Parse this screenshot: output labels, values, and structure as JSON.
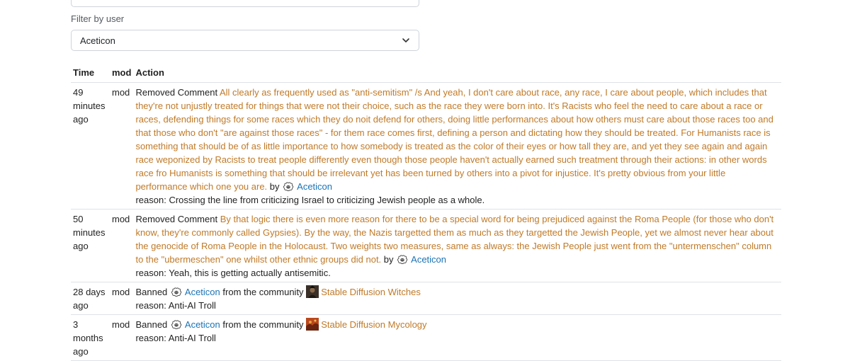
{
  "filter": {
    "label": "Filter by user",
    "selected_user": "Aceticon",
    "top_select_value": ""
  },
  "table": {
    "headers": {
      "time": "Time",
      "mod": "mod",
      "action": "Action"
    },
    "rows": [
      {
        "time": "49 minutes ago",
        "mod": "mod",
        "action": "Removed Comment",
        "content": "All clearly as frequently used as \"anti-semitism\" /s And yeah, I don't care about race, any race, I care about people, which includes that they're not unjustly treated for things that were not their choice, such as the race they were born into. It's Racists who feel the need to care about a race or races, defending things for some races which they do noit defend for others, doing little performances about how others must care about those races too and that those who don't \"are against those races\" - for them race comes first, defining a person and dictating how they should be treated. For Humanists race is something that should be of as little importance to how somebody is treated as the color of their eyes or how tall they are, and yet they see again and again race weponized by Racists to treat people differently even though those people haven't actually earned such treatment through their actions: in other words race fro Humanists is something that should be irrelevant yet has been turned by others into a pivot for injustice. It's pretty obvious from your little performance which one you are.",
        "by": "by",
        "user": "Aceticon",
        "reason_prefix": "reason:",
        "reason": "Crossing the line from criticizing Israel to criticizing Jewish people as a whole."
      },
      {
        "time": "50 minutes ago",
        "mod": "mod",
        "action": "Removed Comment",
        "content": "By that logic there is even more reason for there to be a special word for being prejudiced against the Roma People (for those who don't know, they're commonly called Gypsies). By the way, the Nazis targetted them as much as they targetted the Jewish People, yet we almost never hear about the genocide of Roma People in the Holocaust. Two weights two measures, same as always: the Jewish People just went from the \"untermenschen\" column to the \"ubermeschen\" one whilst other ethnic groups did not.",
        "by": "by",
        "user": "Aceticon",
        "reason_prefix": "reason:",
        "reason": "Yeah, this is getting actually antisemitic."
      },
      {
        "time": "28 days ago",
        "mod": "mod",
        "action": "Banned",
        "user": "Aceticon",
        "from_text": "from the community",
        "community": "Stable Diffusion Witches",
        "community_icon_color": "#3a3028",
        "reason_prefix": "reason:",
        "reason": "Anti-AI Troll"
      },
      {
        "time": "3 months ago",
        "mod": "mod",
        "action": "Banned",
        "user": "Aceticon",
        "from_text": "from the community",
        "community": "Stable Diffusion Mycology",
        "community_icon_color": "#b9481c",
        "reason_prefix": "reason:",
        "reason": "Anti-AI Troll"
      }
    ]
  },
  "colors": {
    "content_text": "#c07a28",
    "user_link": "#1a73b5",
    "border": "#dee2e6"
  },
  "icons": {
    "select_arrow": "chevron-down-icon",
    "user_avatar": "sheep-avatar-icon",
    "community_avatar": "community-avatar-icon"
  }
}
